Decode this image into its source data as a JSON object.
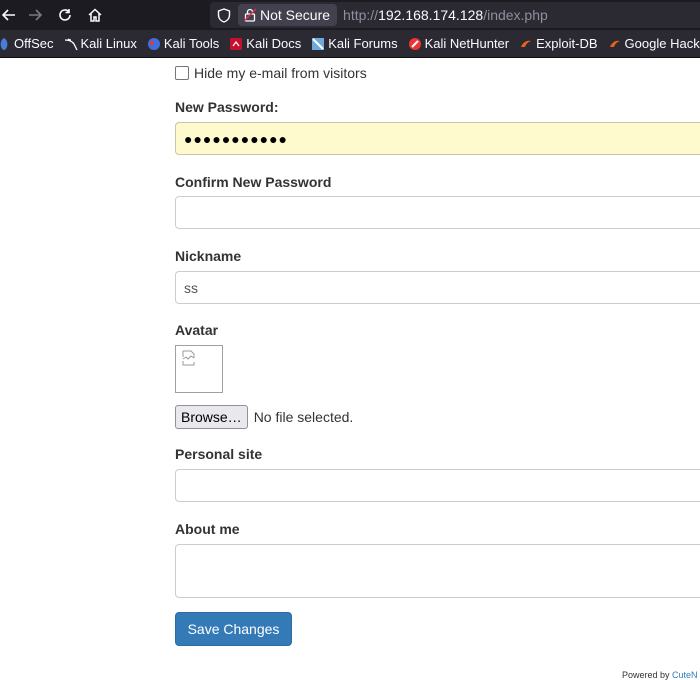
{
  "browser": {
    "security_label": "Not Secure",
    "url_scheme": "http://",
    "url_host": "192.168.174.128",
    "url_path": "/index.php",
    "bookmarks": [
      {
        "label": "OffSec",
        "icon": "offsec-icon"
      },
      {
        "label": "Kali Linux",
        "icon": "kali-dragon-icon"
      },
      {
        "label": "Kali Tools",
        "icon": "kali-tools-icon"
      },
      {
        "label": "Kali Docs",
        "icon": "kali-docs-icon"
      },
      {
        "label": "Kali Forums",
        "icon": "kali-forums-icon"
      },
      {
        "label": "Kali NetHunter",
        "icon": "nethunter-icon"
      },
      {
        "label": "Exploit-DB",
        "icon": "exploit-db-icon"
      },
      {
        "label": "Google Hacking DB",
        "icon": "ghdb-icon"
      }
    ]
  },
  "form": {
    "hide_email_label": "Hide my e-mail from visitors",
    "hide_email_checked": false,
    "new_password_label": "New Password:",
    "new_password_value": "●●●●●●●●●●●",
    "confirm_password_label": "Confirm New Password",
    "confirm_password_value": "",
    "nickname_label": "Nickname",
    "nickname_value": "ss",
    "avatar_label": "Avatar",
    "browse_label": "Browse…",
    "file_status": "No file selected.",
    "personal_site_label": "Personal site",
    "personal_site_value": "",
    "about_me_label": "About me",
    "about_me_value": "",
    "save_label": "Save Changes"
  },
  "footer": {
    "powered_by": "Powered by",
    "powered_link": "CuteN"
  },
  "colors": {
    "chrome_dark": "#1c1b22",
    "urlbar": "#2b2a33",
    "autofill": "#fffacd",
    "primary_button": "#337ab7"
  }
}
